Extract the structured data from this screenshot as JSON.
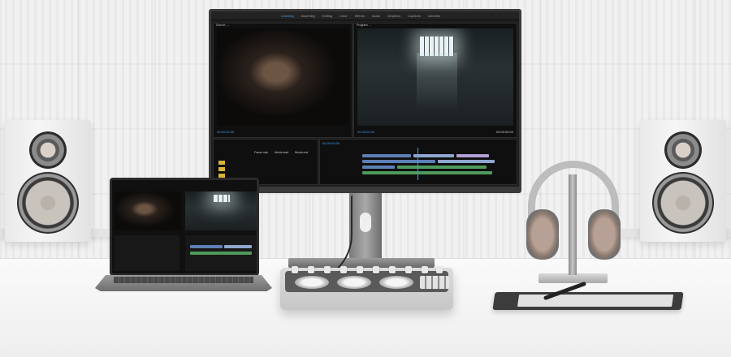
{
  "scene": {
    "description_items": [
      "studio-monitor",
      "laptop",
      "editing-console",
      "headphones",
      "pen-tablet",
      "speakers"
    ]
  },
  "monitor": {
    "app": {
      "workspace_tabs": [
        "Learning",
        "Assembly",
        "Editing",
        "Color",
        "Effects",
        "Audio",
        "Graphics",
        "Captions",
        "Libraries"
      ],
      "active_tab_index": 0,
      "source_panel_title": "Source: ...",
      "program_panel_title": "Program: ...",
      "source_timecode": "00:00:00:00",
      "program_timecode_left": "00:00:00:00",
      "program_timecode_right": "00:00:00:00",
      "timeline_timecode": "00:00:00:00",
      "project_columns": [
        "Frame rate",
        "Media start",
        "Media end"
      ]
    }
  },
  "colors": {
    "accent": "#3b9ff5",
    "panel_bg": "#0f0f0f",
    "wall": "#efefef"
  }
}
